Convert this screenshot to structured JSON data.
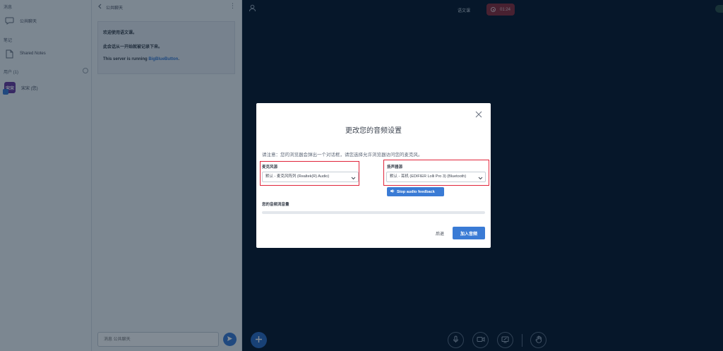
{
  "sidebar": {
    "messages_title": "消息",
    "public_chat": "公共聊天",
    "notes_title": "笔记",
    "shared_notes": "Shared Notes",
    "users_title": "用户 (1)",
    "user": {
      "avatar": "宋宋",
      "name": "宋宋 (您)"
    }
  },
  "chat": {
    "header_title": "公共聊天",
    "welcome_line1": "欢迎使用语文课。",
    "welcome_line2": "此会话从一开始就被记录下来。",
    "welcome_line3_prefix": "This server is running ",
    "welcome_link": "BigBlueButton",
    "welcome_line3_suffix": ".",
    "input_placeholder": "消息 公共聊天"
  },
  "meeting": {
    "title": "语文课",
    "recording_time": "01:24"
  },
  "modal": {
    "title": "更改您的音频设置",
    "note": "请注意：您的浏览器会弹出一个对话框，请您选择允许浏览器访问您的麦克风。",
    "mic_label": "麦克风源",
    "mic_value": "默认 - 麦克风阵列 (Realtek(R) Audio)",
    "speaker_label": "扬声器源",
    "speaker_value": "默认 - 耳机 (EDIFIER Lolli Pro 3) (Bluetooth)",
    "stop_feedback": "Stop audio feedback",
    "volume_label": "您的音频流音量",
    "volume_level": 0,
    "back": "后退",
    "join": "加入音频"
  },
  "colors": {
    "accent": "#3a7bd5",
    "background": "#06172a",
    "highlight_box": "#e0243a",
    "recording": "#8a2a38"
  },
  "icons": [
    "chat-bubble-icon",
    "notes-icon",
    "gear-icon",
    "chevron-left-icon",
    "more-vertical-icon",
    "send-icon",
    "user-icon",
    "record-icon",
    "plus-icon",
    "microphone-icon",
    "camera-icon",
    "screen-share-icon",
    "hand-icon",
    "close-icon",
    "chevron-down-icon",
    "speaker-icon"
  ]
}
